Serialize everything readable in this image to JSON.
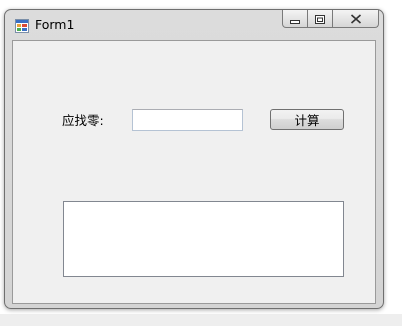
{
  "window": {
    "title": "Form1",
    "icons": {
      "app": "form-app-icon",
      "minimize": "minimize-icon",
      "maximize": "maximize-icon",
      "close": "close-icon"
    }
  },
  "form": {
    "change_label": "应找零:",
    "change_input_value": "",
    "calculate_button_label": "计算",
    "output_text": ""
  }
}
